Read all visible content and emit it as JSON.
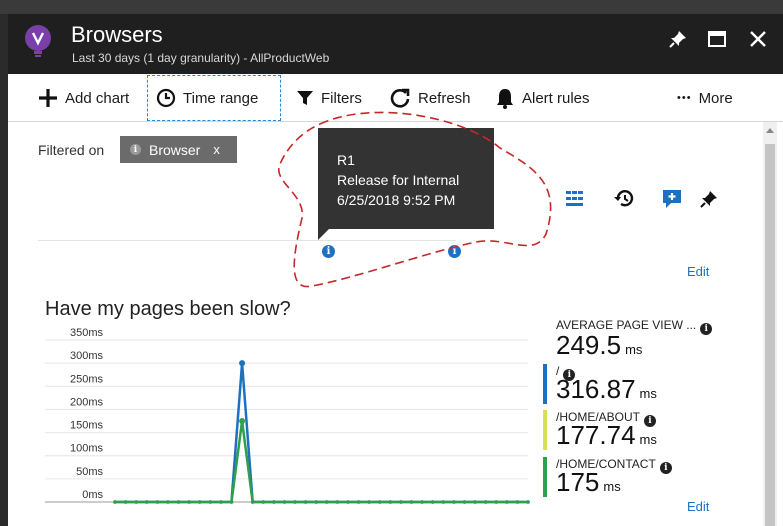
{
  "blade": {
    "title": "Browsers",
    "subtitle": "Last 30 days (1 day granularity) - AllProductWeb"
  },
  "window_controls": [
    {
      "name": "pin-icon"
    },
    {
      "name": "maximize-icon"
    },
    {
      "name": "close-icon"
    }
  ],
  "toolbar": {
    "add_chart": "Add chart",
    "time_range": "Time range",
    "filters": "Filters",
    "refresh": "Refresh",
    "alert_rules": "Alert rules",
    "more": "More",
    "more_glyph": "•••"
  },
  "filter": {
    "label": "Filtered on",
    "chip_text": "Browser",
    "chip_remove": "x"
  },
  "annotation_tooltip": {
    "line1": "R1",
    "line2": "Release for Internal",
    "line3": "6/25/2018 9:52 PM"
  },
  "annotation_markers": [
    {
      "glyph": "i"
    },
    {
      "glyph": "i"
    }
  ],
  "edit_label": "Edit",
  "chart": {
    "title": "Have my pages been slow?"
  },
  "chart_data": {
    "type": "line",
    "title": "Have my pages been slow?",
    "ylim": [
      0,
      350
    ],
    "yticks": [
      "0ms",
      "50ms",
      "100ms",
      "150ms",
      "200ms",
      "250ms",
      "300ms",
      "350ms"
    ],
    "ytick_values": [
      0,
      50,
      100,
      150,
      200,
      250,
      300,
      350
    ],
    "grid": true,
    "series": [
      {
        "name": "/",
        "color": "#1e70c1",
        "values": [
          0,
          0,
          0,
          0,
          0,
          0,
          0,
          0,
          0,
          0,
          0,
          0,
          300,
          0,
          0,
          0,
          0,
          0,
          0,
          0,
          0,
          0,
          0,
          0,
          0,
          0,
          0,
          0,
          0,
          0,
          0,
          0,
          0,
          0,
          0,
          0,
          0,
          0,
          0,
          0
        ]
      },
      {
        "name": "/HOME/ABOUT",
        "color": "#2ca04a",
        "values": [
          0,
          0,
          0,
          0,
          0,
          0,
          0,
          0,
          0,
          0,
          0,
          0,
          175,
          0,
          0,
          0,
          0,
          0,
          0,
          0,
          0,
          0,
          0,
          0,
          0,
          0,
          0,
          0,
          0,
          0,
          0,
          0,
          0,
          0,
          0,
          0,
          0,
          0,
          0,
          0
        ]
      }
    ]
  },
  "metrics": [
    {
      "label": "AVERAGE PAGE VIEW ...",
      "value": "249.5",
      "unit": "ms",
      "color": ""
    },
    {
      "label": "/",
      "value": "316.87",
      "unit": "ms",
      "color": "#1e70c1"
    },
    {
      "label": "/HOME/ABOUT",
      "value": "177.74",
      "unit": "ms",
      "color": "#d4e157"
    },
    {
      "label": "/HOME/CONTACT",
      "value": "175",
      "unit": "ms",
      "color": "#2ca04a"
    }
  ],
  "info_glyph": "i",
  "colors": {
    "accent": "#1e70c1",
    "titlebar": "#1f1f1f",
    "highlight": "#c62828"
  }
}
